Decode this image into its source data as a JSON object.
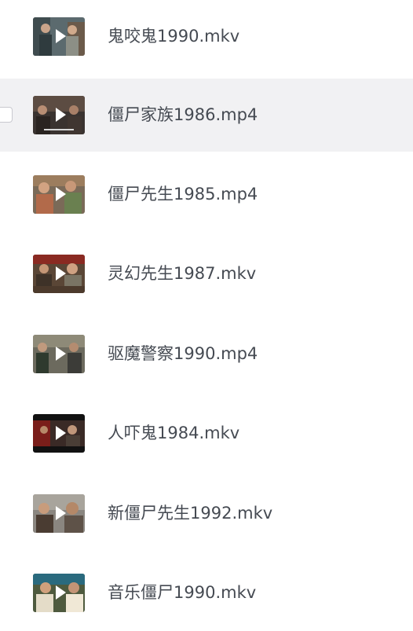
{
  "files": [
    {
      "name": "鬼咬鬼1990.mkv",
      "selected": false,
      "thumb_icon": "video-thumbnail-icon"
    },
    {
      "name": "僵尸家族1986.mp4",
      "selected": false,
      "hovered": true,
      "thumb_icon": "video-thumbnail-icon"
    },
    {
      "name": "僵尸先生1985.mp4",
      "selected": false,
      "thumb_icon": "video-thumbnail-icon"
    },
    {
      "name": "灵幻先生1987.mkv",
      "selected": false,
      "thumb_icon": "video-thumbnail-icon"
    },
    {
      "name": "驱魔警察1990.mp4",
      "selected": false,
      "thumb_icon": "video-thumbnail-icon"
    },
    {
      "name": "人吓鬼1984.mkv",
      "selected": false,
      "thumb_icon": "video-thumbnail-icon"
    },
    {
      "name": "新僵尸先生1992.mkv",
      "selected": false,
      "thumb_icon": "video-thumbnail-icon"
    },
    {
      "name": "音乐僵尸1990.mkv",
      "selected": false,
      "thumb_icon": "video-thumbnail-icon"
    }
  ],
  "colors": {
    "hover_background": "#f1f1f3",
    "text": "#454a52",
    "checkbox_border": "#c9c9cf"
  }
}
